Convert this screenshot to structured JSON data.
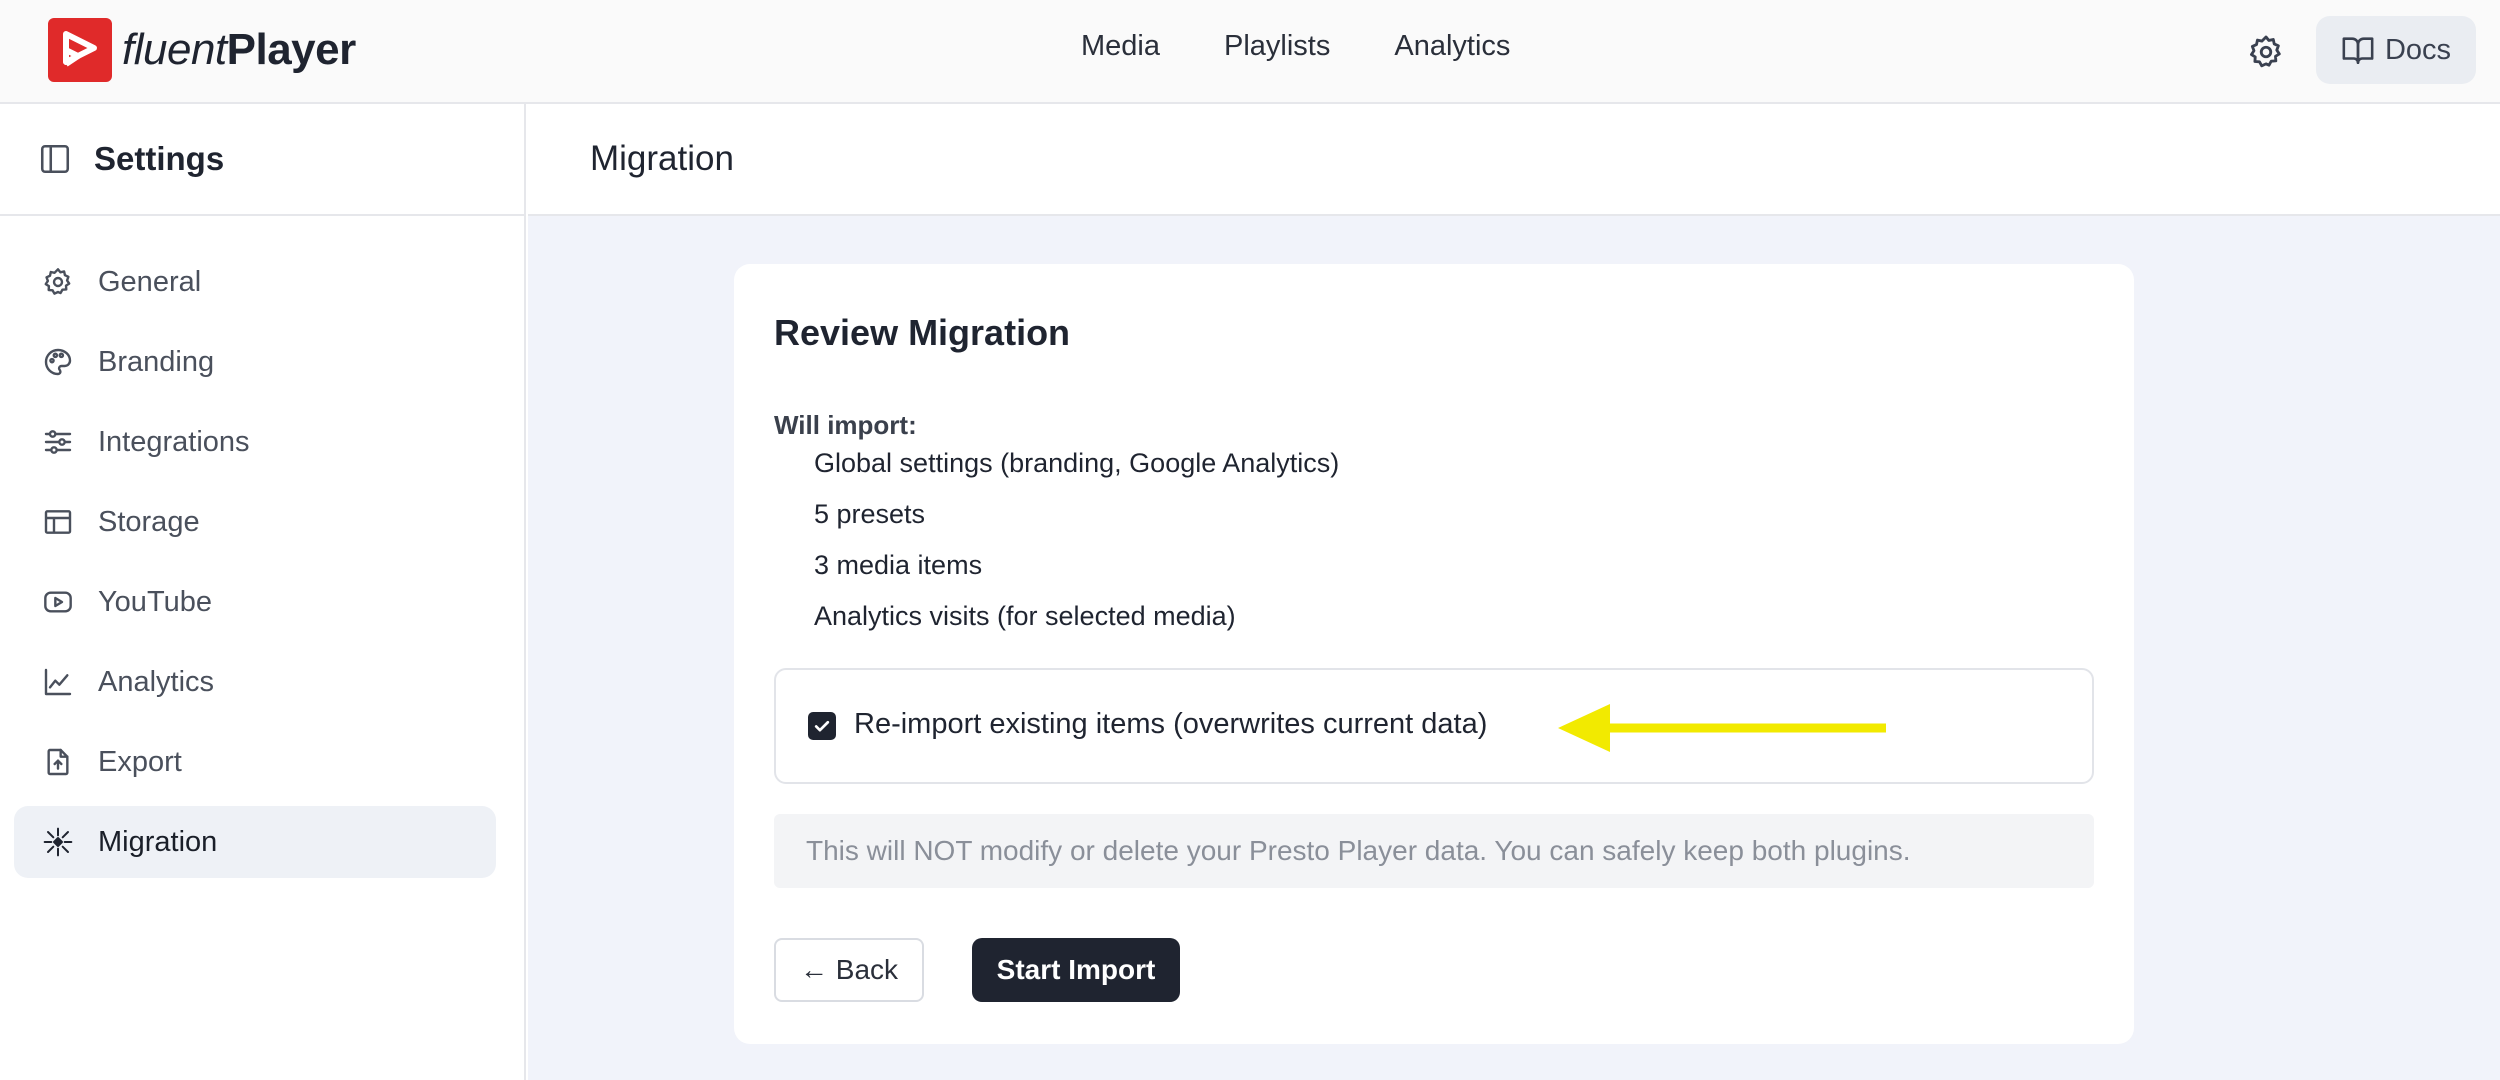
{
  "brand": {
    "name_light": "fluent",
    "name_bold": "Player",
    "logo_color": "#e02a2a"
  },
  "topnav": {
    "items": [
      {
        "label": "Media"
      },
      {
        "label": "Playlists"
      },
      {
        "label": "Analytics"
      }
    ]
  },
  "header_actions": {
    "settings_icon": "gear-icon",
    "docs_label": "Docs",
    "docs_icon": "book-icon"
  },
  "sidebar": {
    "title": "Settings",
    "toggle_icon": "sidebar-toggle-icon",
    "items": [
      {
        "label": "General",
        "icon": "gear-icon"
      },
      {
        "label": "Branding",
        "icon": "palette-icon"
      },
      {
        "label": "Integrations",
        "icon": "sliders-icon"
      },
      {
        "label": "Storage",
        "icon": "layout-icon"
      },
      {
        "label": "YouTube",
        "icon": "youtube-icon"
      },
      {
        "label": "Analytics",
        "icon": "chart-icon"
      },
      {
        "label": "Export",
        "icon": "export-icon"
      },
      {
        "label": "Migration",
        "icon": "migration-icon",
        "active": true
      }
    ]
  },
  "main": {
    "title": "Migration",
    "card": {
      "title": "Review Migration",
      "import_label": "Will import:",
      "import_items": [
        "Global settings (branding, Google Analytics)",
        "5 presets",
        "3 media items",
        "Analytics visits (for selected media)"
      ],
      "reimport": {
        "label": "Re-import existing items (overwrites current data)",
        "checked": true
      },
      "notice": "This will NOT modify or delete your Presto Player data. You can safely keep both plugins.",
      "back_label": "← Back",
      "start_label": "Start Import"
    }
  },
  "colors": {
    "accent_dark": "#1f2430",
    "annotation_arrow": "#f2ea00",
    "main_bg": "#f1f3fa"
  }
}
